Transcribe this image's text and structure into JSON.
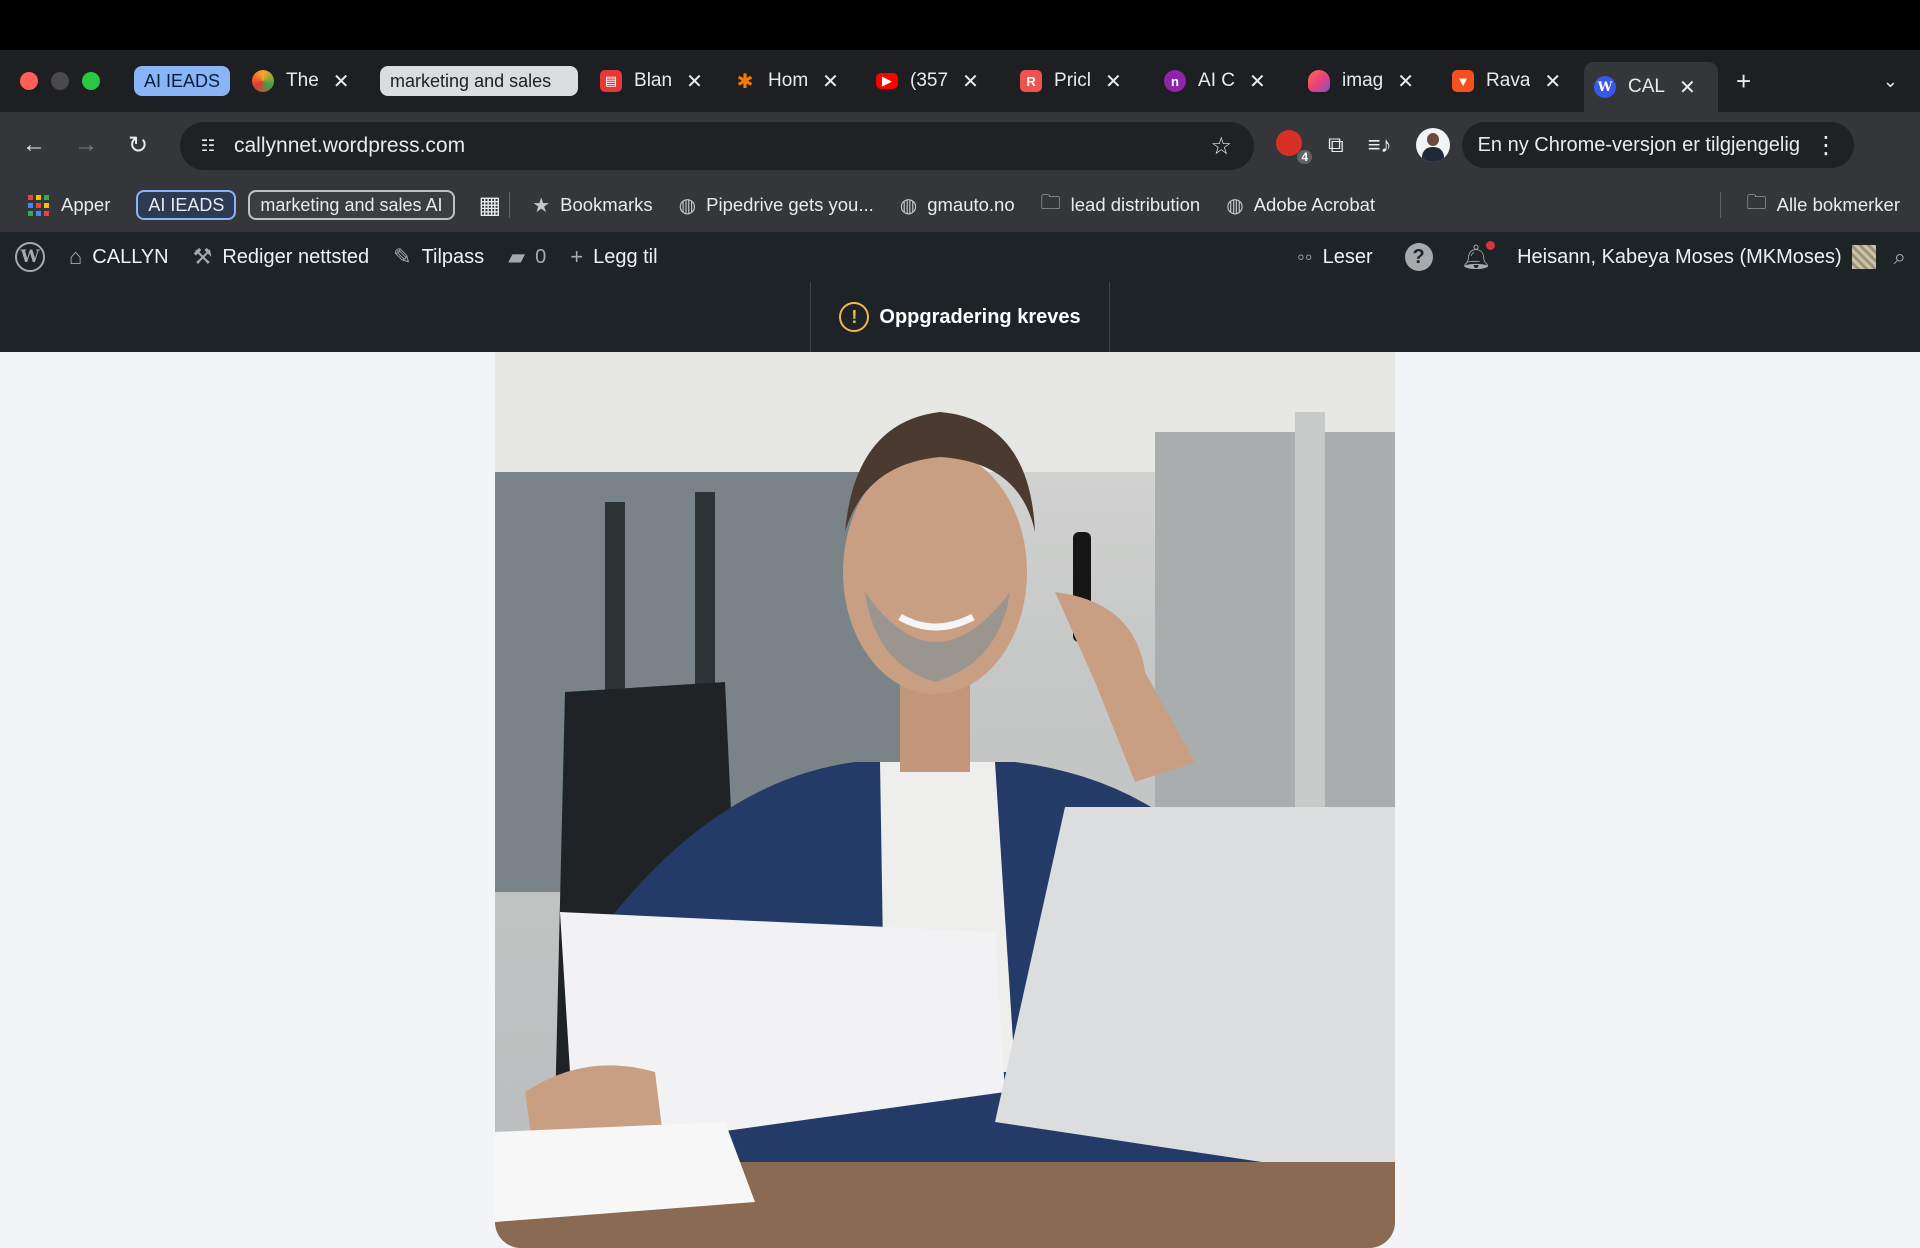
{
  "browser": {
    "tab_groups": [
      "AI IEADS",
      "marketing and sales"
    ],
    "tabs": [
      {
        "title": "The",
        "icon": "chrome-color-icon",
        "color": "#f9a825"
      },
      {
        "title": "Blan",
        "icon": "document-icon",
        "color": "#e53935"
      },
      {
        "title": "Hom",
        "icon": "asterisk-icon",
        "color": "#f57c00"
      },
      {
        "title": "(357",
        "icon": "youtube-icon",
        "color": "#ff0000"
      },
      {
        "title": "Pricl",
        "icon": "pricing-icon",
        "color": "#ef5350"
      },
      {
        "title": "AI C",
        "icon": "ai-logo-icon",
        "color": "#8e24aa"
      },
      {
        "title": "imag",
        "icon": "gradient-icon",
        "color": "#ec407a"
      },
      {
        "title": "Rava",
        "icon": "rava-icon",
        "color": "#f4511e"
      },
      {
        "title": "CAL",
        "icon": "wordpress-icon",
        "color": "#3858e9",
        "active": true
      }
    ],
    "url": "callynnet.wordpress.com",
    "extension_badge": "4",
    "update_notice": "En ny Chrome-versjon er tilgjengelig",
    "bookmarks": {
      "apps": "Apper",
      "chips": [
        "AI IEADS",
        "marketing and sales AI"
      ],
      "items": [
        {
          "label": "Bookmarks",
          "icon": "star-icon"
        },
        {
          "label": "Pipedrive gets you...",
          "icon": "globe-icon"
        },
        {
          "label": "gmauto.no",
          "icon": "globe-icon"
        },
        {
          "label": "lead distribution",
          "icon": "folder-icon"
        },
        {
          "label": "Adobe Acrobat",
          "icon": "globe-icon"
        }
      ],
      "all": "Alle bokmerker"
    }
  },
  "wp_admin": {
    "site": "CALLYN",
    "edit_site": "Rediger nettsted",
    "customize": "Tilpass",
    "comments_count": "0",
    "add_new": "Legg til",
    "reader": "Leser",
    "greeting": "Heisann, Kabeya Moses (MKMoses)"
  },
  "notice": {
    "text": "Oppgradering kreves"
  },
  "colors": {
    "wp_bar": "#1d2327",
    "chrome_toolbar": "#35363a",
    "page_bg": "#f3f4f8"
  }
}
